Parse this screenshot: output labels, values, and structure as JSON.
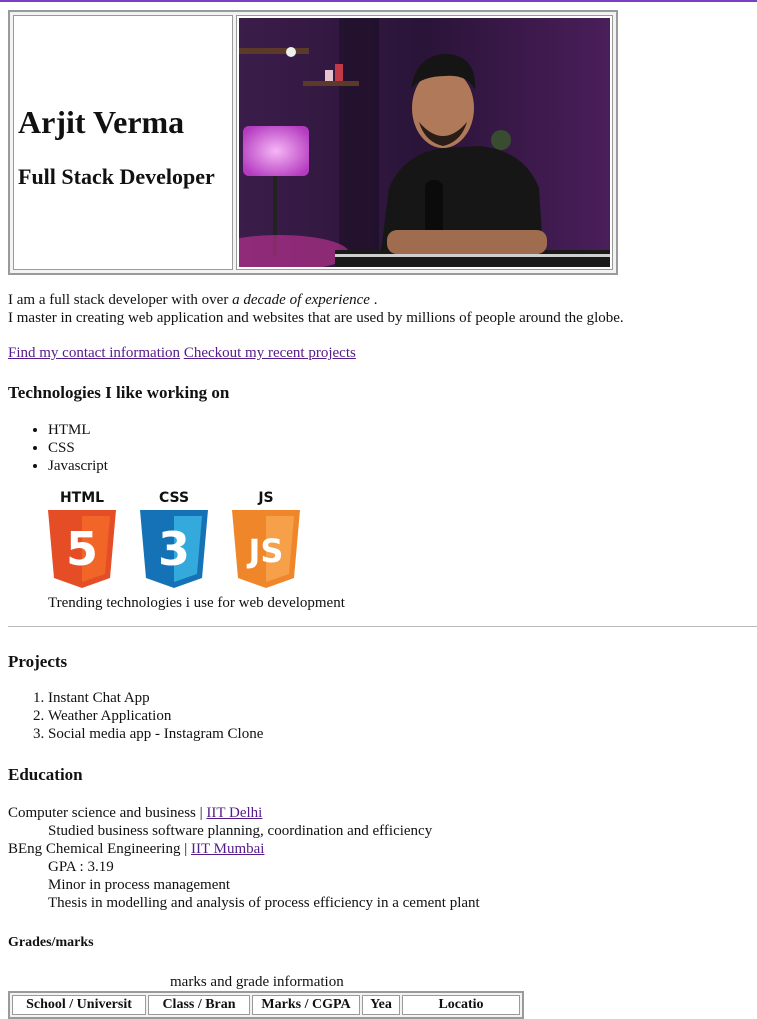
{
  "header": {
    "name": "Arjit Verma",
    "role": "Full Stack Developer"
  },
  "intro": {
    "line1_before": "I am a full stack developer with over ",
    "line1_em": "a decade of experience",
    "line1_after": " .",
    "line2": "I master in creating web application and websites that are used by millions of people around the globe."
  },
  "links": {
    "contact": "Find my contact information",
    "projects": "Checkout my recent projects"
  },
  "technologies": {
    "heading": "Technologies I like working on",
    "items": [
      "HTML",
      "CSS",
      "Javascript"
    ],
    "logos": [
      {
        "label": "HTML",
        "glyph": "5",
        "color": "#e44d26",
        "shade": "#f16529"
      },
      {
        "label": "CSS",
        "glyph": "3",
        "color": "#1572b6",
        "shade": "#33a9dc"
      },
      {
        "label": "JS",
        "glyph": "JS",
        "color": "#f0862a",
        "shade": "#f7a04a"
      }
    ],
    "caption": "Trending technologies i use for web development"
  },
  "projects": {
    "heading": "Projects",
    "items": [
      "Instant Chat App",
      "Weather Application",
      "Social media app - Instagram Clone"
    ]
  },
  "education": {
    "heading": "Education",
    "entries": [
      {
        "degree": "Computer science and business | ",
        "school": "IIT Delhi",
        "details": [
          "Studied business software planning, coordination and efficiency"
        ]
      },
      {
        "degree": "BEng Chemical Engineering | ",
        "school": "IIT Mumbai",
        "details": [
          "GPA : 3.19",
          "Minor in process management",
          "Thesis in modelling and analysis of process efficiency in a cement plant"
        ]
      }
    ]
  },
  "grades": {
    "heading": "Grades/marks",
    "caption": "marks and grade information",
    "columns": [
      "School / Universit",
      "Class / Bran",
      "Marks / CGPA",
      "Yea",
      "Locatio"
    ]
  },
  "colors": {
    "accent_bar": "#7a3fc4",
    "link": "#551a8b"
  }
}
